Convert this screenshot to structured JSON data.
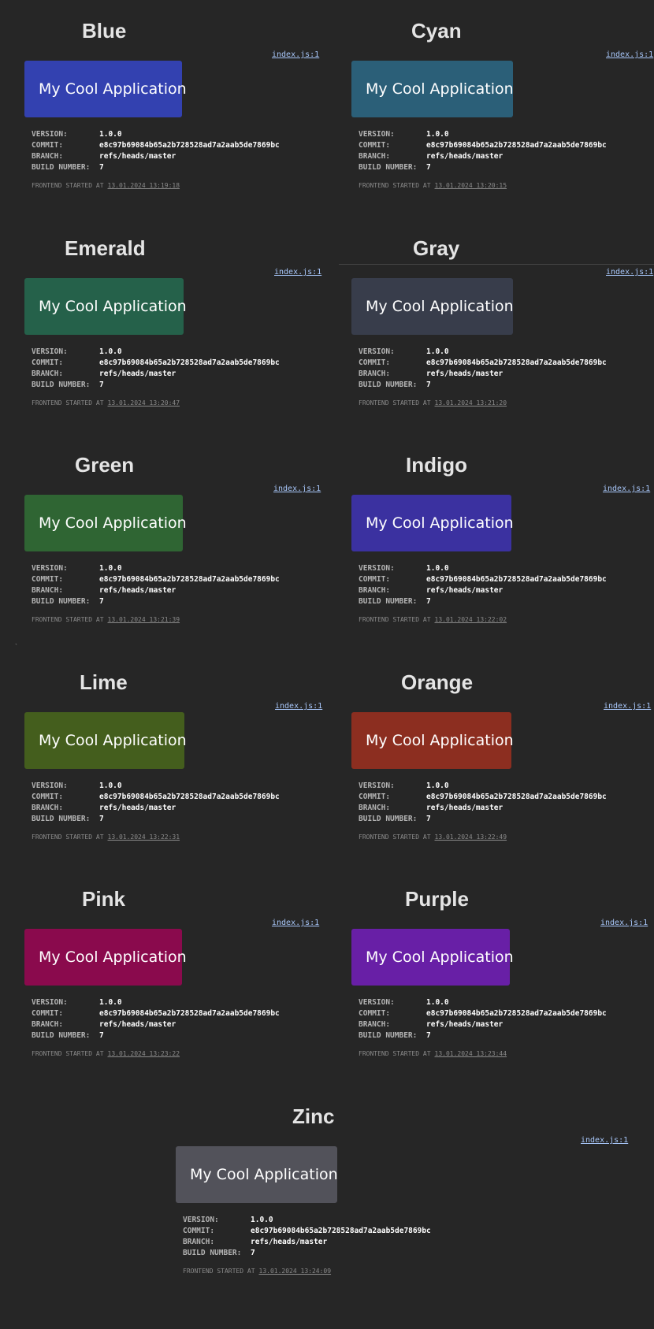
{
  "source_link": "index.js:1",
  "info_labels": {
    "version": "VERSION:",
    "commit": "COMMIT:",
    "branch": "BRANCH:",
    "build": "BUILD NUMBER:",
    "started": "FRONTEND STARTED AT"
  },
  "build_info": {
    "version": "1.0.0",
    "commit": "e8c97b69084b65a2b728528ad7a2aab5de7869bc",
    "branch": "refs/heads/master",
    "build_number": "7"
  },
  "app_title": "My Cool Application",
  "themes": [
    {
      "name": "Blue",
      "color": "#3341b0",
      "started": "13.01.2024 13:19:18"
    },
    {
      "name": "Cyan",
      "color": "#2b5f78",
      "started": "13.01.2024 13:20:15"
    },
    {
      "name": "Emerald",
      "color": "#25614a",
      "started": "13.01.2024 13:20:47"
    },
    {
      "name": "Gray",
      "color": "#383d4b",
      "started": "13.01.2024 13:21:20"
    },
    {
      "name": "Green",
      "color": "#2f6533",
      "started": "13.01.2024 13:21:39"
    },
    {
      "name": "Indigo",
      "color": "#3b31a0",
      "started": "13.01.2024 13:22:02"
    },
    {
      "name": "Lime",
      "color": "#445e1d",
      "started": "13.01.2024 13:22:31"
    },
    {
      "name": "Orange",
      "color": "#8c2e20",
      "started": "13.01.2024 13:22:49"
    },
    {
      "name": "Pink",
      "color": "#8a0a4d",
      "started": "13.01.2024 13:23:22"
    },
    {
      "name": "Purple",
      "color": "#681fa6",
      "started": "13.01.2024 13:23:44"
    },
    {
      "name": "Zinc",
      "color": "#52525a",
      "started": "13.01.2024 13:24:09"
    }
  ]
}
